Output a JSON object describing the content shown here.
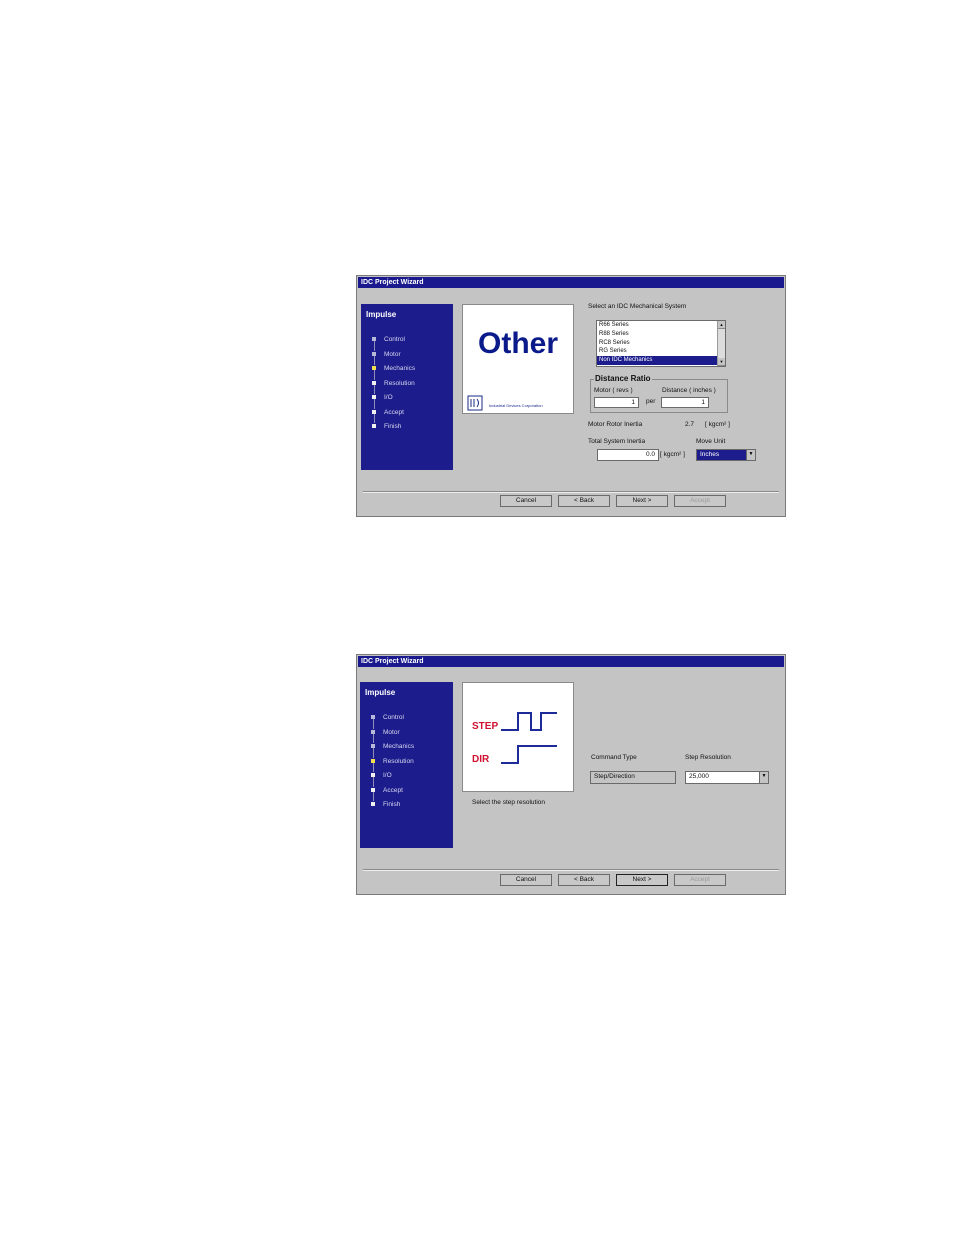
{
  "window1": {
    "title": "IDC Project Wizard",
    "side_title": "Impulse",
    "steps": [
      "Control",
      "Motor",
      "Mechanics",
      "Resolution",
      "I/O",
      "Accept",
      "Finish"
    ],
    "image_title": "Other",
    "logo_caption": "Industrial Devices Corporation",
    "select_label": "Select an IDC Mechanical System",
    "systems": [
      "R66 Series",
      "R88 Series",
      "RC8 Series",
      "RG Series",
      "Non IDC Mechanics"
    ],
    "selected_system": "Non IDC Mechanics",
    "ratio_group": "Distance Ratio",
    "motor_label": "Motor ( revs )",
    "distance_label": "Distance ( inches )",
    "per_label": "per",
    "motor_value": "1",
    "distance_value": "1",
    "rotor_inertia_label": "Motor Rotor Inertia",
    "rotor_inertia_value": "2.7",
    "inertia_unit": "[ kgcm² ]",
    "total_inertia_label": "Total System Inertia",
    "total_inertia_value": "0.0",
    "total_inertia_unit": "[ kgcm² ]",
    "move_unit_label": "Move Unit",
    "move_unit_value": "Inches",
    "buttons": {
      "cancel": "Cancel",
      "back": "< Back",
      "next": "Next >",
      "accept": "Accept"
    }
  },
  "window2": {
    "title": "IDC Project Wizard",
    "side_title": "Impulse",
    "steps": [
      "Control",
      "Motor",
      "Mechanics",
      "Resolution",
      "I/O",
      "Accept",
      "Finish"
    ],
    "step_label": "STEP",
    "dir_label": "DIR",
    "hint": "Select the step resolution",
    "command_type_label": "Command Type",
    "command_type_value": "Step/Direction",
    "step_res_label": "Step Resolution",
    "step_res_value": "25,000",
    "buttons": {
      "cancel": "Cancel",
      "back": "< Back",
      "next": "Next >",
      "accept": "Accept"
    }
  },
  "colors": {
    "titlebar": "#1a1a8e",
    "sidepanel": "#1c1c8c",
    "dialog": "#c4c4c4",
    "current_step": "#f2e050",
    "signal_label": "#d01030",
    "signal_line": "#1c2a9a"
  }
}
